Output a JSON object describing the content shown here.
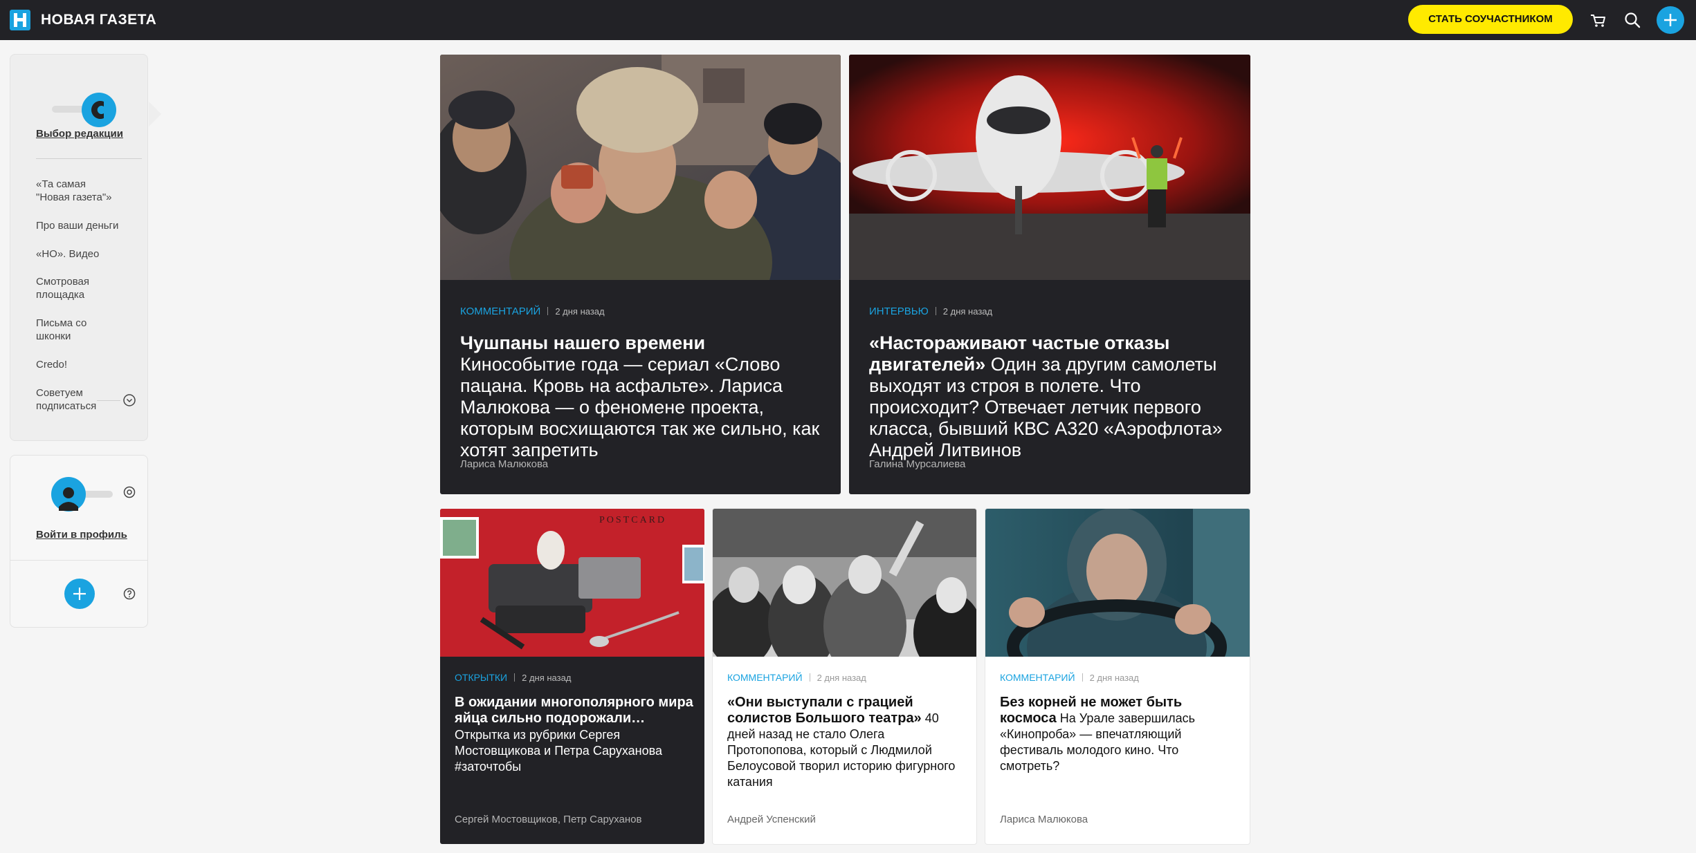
{
  "header": {
    "logo_text": "НОВАЯ ГАЗЕТА",
    "cta_label": "СТАТЬ СОУЧАСТНИКОМ",
    "icons": [
      "cart-icon",
      "search-icon",
      "plus-icon"
    ],
    "colors": {
      "bar": "#222226",
      "accent": "#1aa3e0",
      "cta": "#ffea00"
    }
  },
  "sidebar": {
    "section_title": "Выбор редакции",
    "items": [
      {
        "label": "«Та самая\n\"Новая газета\"»"
      },
      {
        "label": "Про ваши деньги"
      },
      {
        "label": "«НО». Видео"
      },
      {
        "label": "Смотровая\nплощадка"
      },
      {
        "label": "Письма со\nшконки"
      },
      {
        "label": "Credo!"
      },
      {
        "label": "Советуем\nподписаться"
      }
    ],
    "profile_label": "Войти в профиль"
  },
  "articles": [
    {
      "rubric": "КОММЕНТАРИЙ",
      "time": "2 дня назад",
      "title": "Чушпаны нашего времени",
      "lead": " Кинособытие года — сериал «Слово пацана. Кровь на асфальте». Лариса Малюкова — о феномене проекта, которым восхищаются так же сильно, как хотят запретить",
      "author": "Лариса Малюкова"
    },
    {
      "rubric": "ИНТЕРВЬЮ",
      "time": "2 дня назад",
      "title": "«Настораживают частые отказы двигателей»",
      "lead": " Один за другим самолеты выходят из строя в полете. Что происходит? Отвечает летчик первого класса, бывший КВС А320 «Аэрофлота» Андрей Литвинов",
      "author": "Галина Мурсалиева"
    },
    {
      "rubric": "ОТКРЫТКИ",
      "time": "2 дня назад",
      "title": "В ожидании многополярного мира яйца сильно подорожали…",
      "lead": "Открытка из рубрики Сергея Мостовщикова и Петра Саруханова #заточтобы",
      "author": "Сергей Мостовщиков, Петр Саруханов",
      "image_caption": "POSTCARD"
    },
    {
      "rubric": "КОММЕНТАРИЙ",
      "time": "2 дня назад",
      "title": "«Они выступали с грацией солистов Большого театра»",
      "lead": " 40 дней назад не стало Олега Протопопова, который с Людмилой Белоусовой творил историю фигурного катания",
      "author": "Андрей Успенский"
    },
    {
      "rubric": "КОММЕНТАРИЙ",
      "time": "2 дня назад",
      "title": "Без корней не может быть космоса",
      "lead": " На Урале завершилась «Кинопроба» — впечатляющий фестиваль молодого кино. Что смотреть?",
      "author": "Лариса Малюкова"
    }
  ]
}
